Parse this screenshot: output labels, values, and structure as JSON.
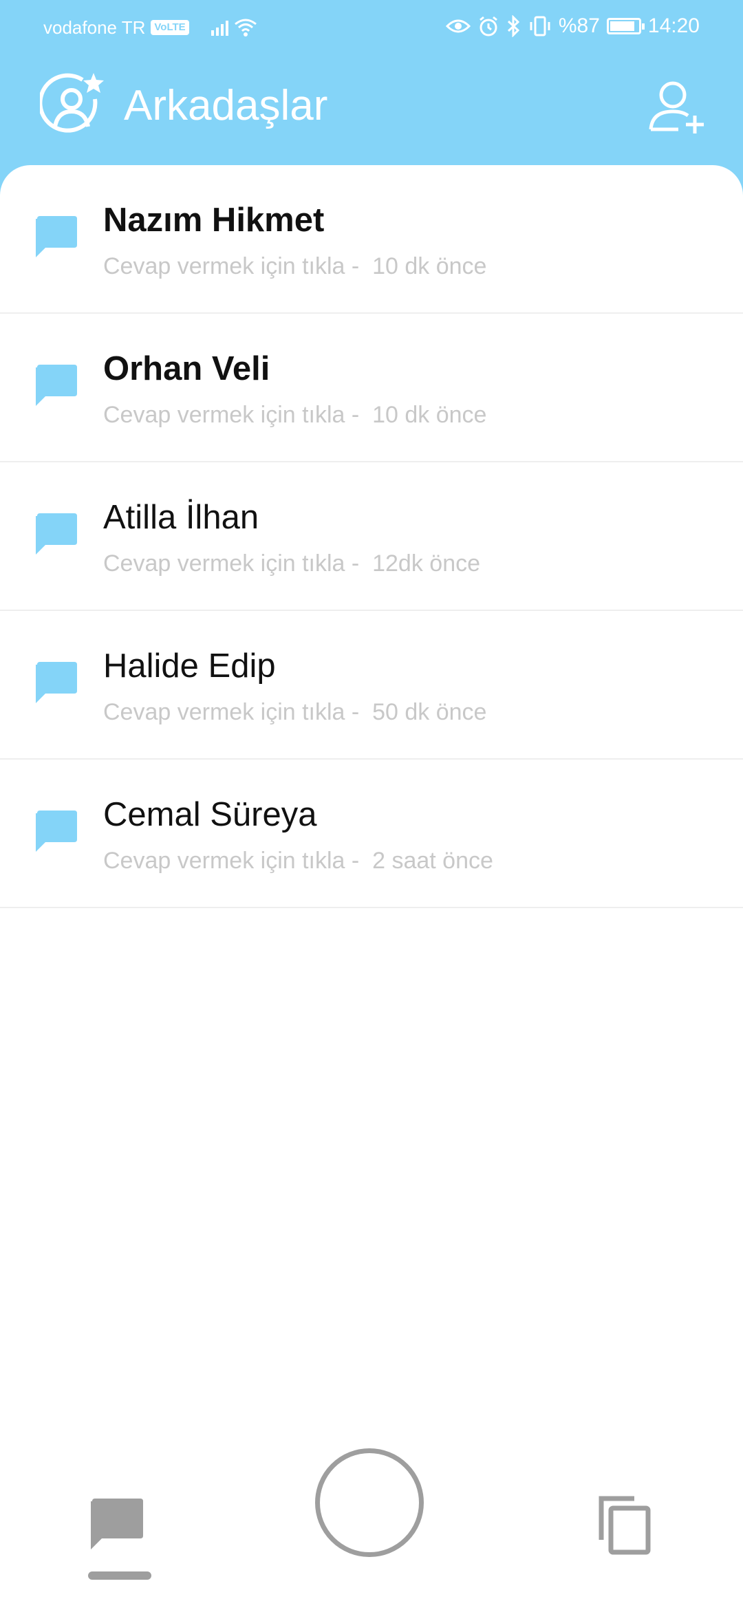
{
  "status_bar": {
    "carrier": "vodafone TR",
    "volte": "VoLTE",
    "battery_percent": "%87",
    "battery_level": 0.87,
    "time": "14:20",
    "icons": [
      "signal-icon",
      "wifi-icon",
      "eye-icon",
      "alarm-icon",
      "bluetooth-icon",
      "vibrate-icon",
      "battery-icon"
    ]
  },
  "header": {
    "title": "Arkadaşlar",
    "logo_icon": "friends-star-icon",
    "action_icon": "add-friend-icon"
  },
  "colors": {
    "header_bg": "#84d4f8",
    "chat_icon": "#84d4f8",
    "subtitle": "#c8c8c8",
    "nav_icon": "#9e9e9e"
  },
  "conversations": [
    {
      "name": "Nazım Hikmet",
      "subtitle": "Cevap vermek için tıkla -  10 dk önce",
      "unread": true
    },
    {
      "name": "Orhan Veli",
      "subtitle": "Cevap vermek için tıkla -  10 dk önce",
      "unread": true
    },
    {
      "name": "Atilla İlhan",
      "subtitle": "Cevap vermek için tıkla -  12dk önce",
      "unread": false
    },
    {
      "name": "Halide Edip",
      "subtitle": "Cevap vermek için tıkla -  50 dk önce",
      "unread": false
    },
    {
      "name": "Cemal Süreya",
      "subtitle": "Cevap vermek için tıkla -  2 saat önce",
      "unread": false
    }
  ],
  "bottom_nav": {
    "items": [
      "chat-icon",
      "home-circle-icon",
      "copy-icon"
    ],
    "selected": 0
  }
}
